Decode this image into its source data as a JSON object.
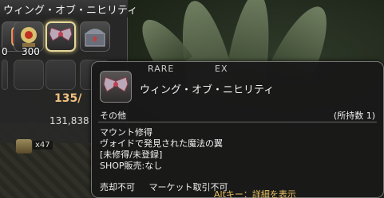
{
  "inventory": {
    "title": "ウィング・オブ・ニヒリティ",
    "slot1_count": "0",
    "slot2_count": "300",
    "counter": "135/",
    "gil": "131,838",
    "bottom_count": "x47"
  },
  "tooltip": {
    "tag_rarity": "RARE",
    "tag_ex": "EX",
    "item_name": "ウィング・オブ・ニヒリティ",
    "category": "その他",
    "owned": "(所持数 1)",
    "desc_line1": "マウント修得",
    "desc_line2": "ヴォイドで発見された魔法の翼",
    "desc_line3": "[未修得/未登録]",
    "desc_line4": "SHOP販売:なし",
    "footer_no_sell": "売却不可",
    "footer_no_market": "マーケット取引不可"
  },
  "hint": {
    "text": "Altキー：詳細を表示"
  },
  "colors": {
    "selected_slot_border": "#e6d79a",
    "counter": "#f0c080",
    "tooltip_bg": "#181818"
  }
}
